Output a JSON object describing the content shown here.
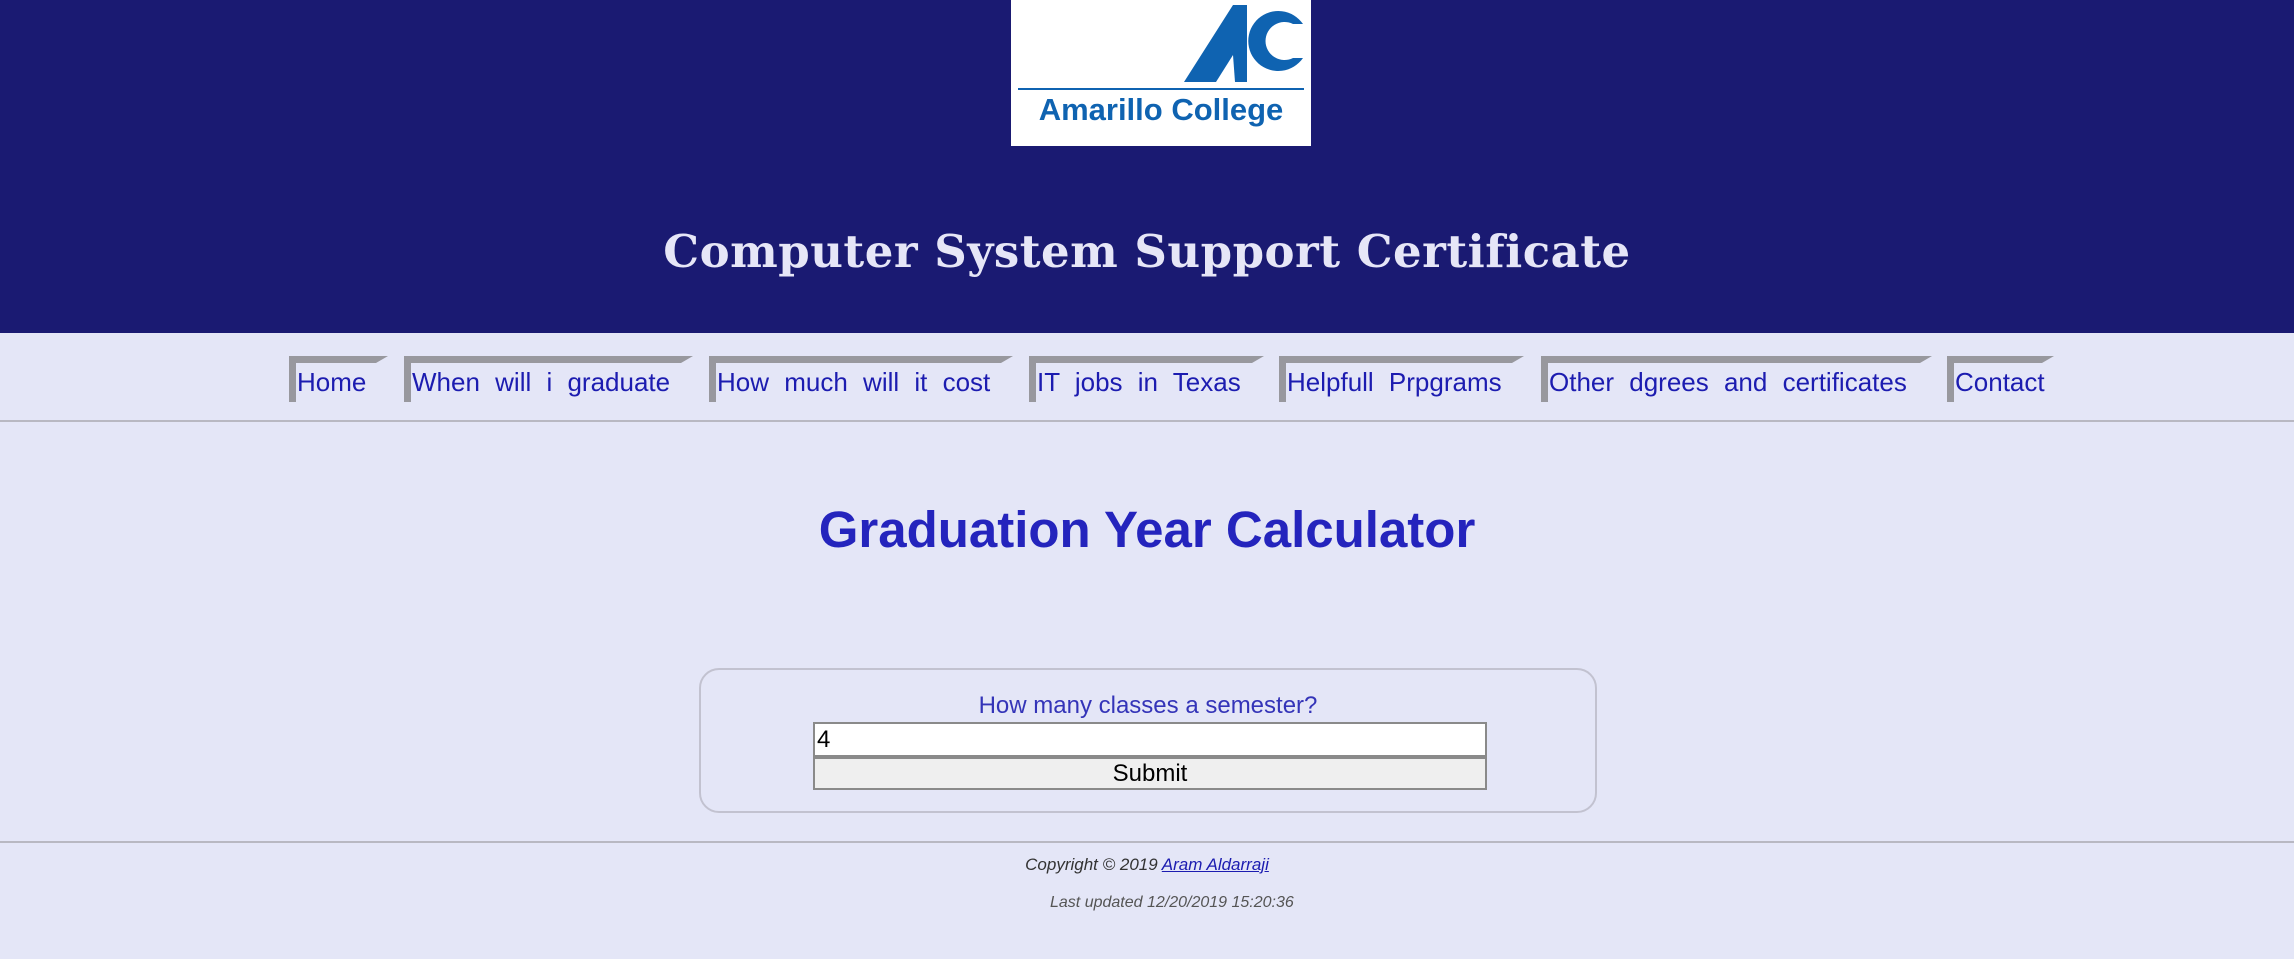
{
  "header": {
    "logo_text": "Amarillo College",
    "logo_mark": "AC",
    "title": "Computer System Support Certificate",
    "colors": {
      "header_bg": "#1a1a72",
      "logo_blue": "#0f63b1"
    }
  },
  "nav": {
    "items": [
      {
        "label": "Home"
      },
      {
        "label": "When will i graduate"
      },
      {
        "label": "How much will it cost"
      },
      {
        "label": "IT jobs in Texas"
      },
      {
        "label": "Helpfull Prpgrams"
      },
      {
        "label": "Other dgrees and certificates"
      },
      {
        "label": "Contact"
      }
    ]
  },
  "main": {
    "heading": "Graduation Year Calculator",
    "form": {
      "label": "How many classes a semester?",
      "input_value": "4",
      "submit_label": "Submit"
    }
  },
  "footer": {
    "copyright_prefix": "Copyright © 2019",
    "author": "Aram Aldarraji",
    "last_updated": "Last updated 12/20/2019 15:20:36"
  }
}
